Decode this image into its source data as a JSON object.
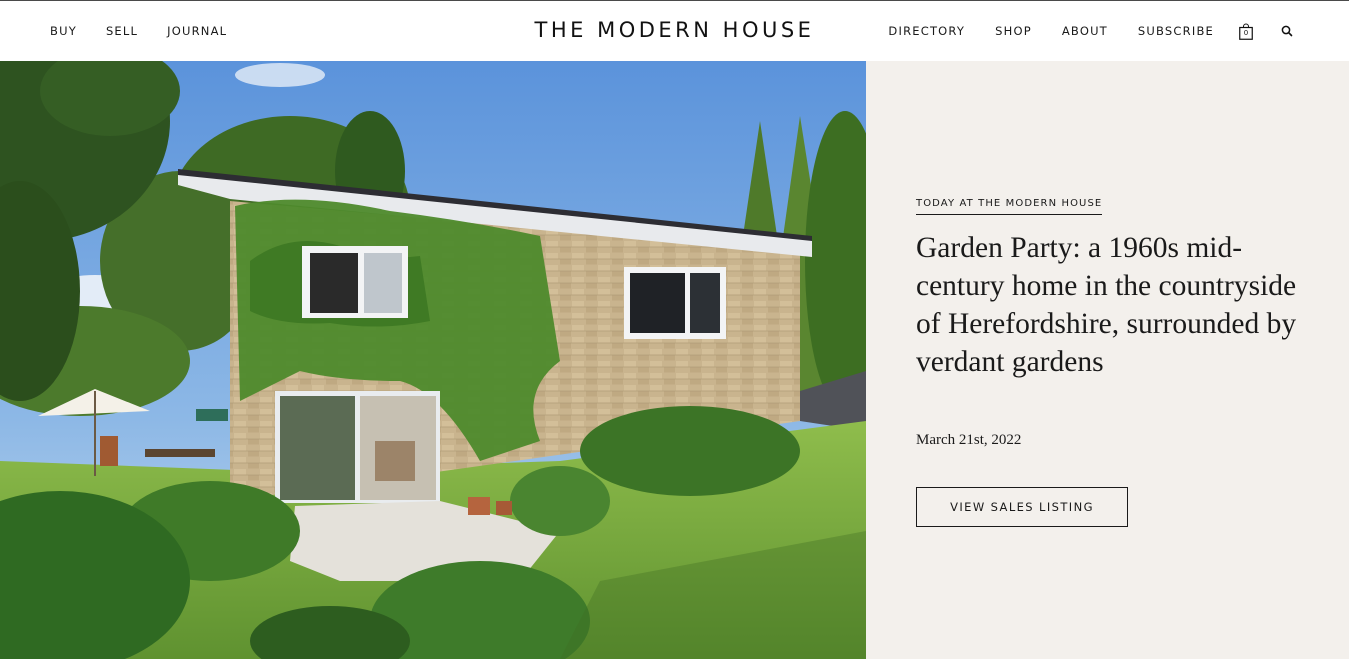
{
  "brand": {
    "name": "THE MODERN HOUSE"
  },
  "nav": {
    "left": [
      "BUY",
      "SELL",
      "JOURNAL"
    ],
    "right": [
      "DIRECTORY",
      "SHOP",
      "ABOUT",
      "SUBSCRIBE"
    ],
    "bag_count": "0",
    "icons": {
      "bag": "shopping-bag-icon",
      "search": "search-icon"
    }
  },
  "feature": {
    "kicker": "TODAY AT THE MODERN HOUSE",
    "headline": "Garden Party: a 1960s mid-century home in the countryside of Herefordshire, surrounded by verdant gardens",
    "date": "March 21st, 2022",
    "cta_label": "VIEW SALES LISTING"
  },
  "colors": {
    "panel_background": "#f3f0ec",
    "text": "#1a1a1a",
    "header_background": "#ffffff"
  }
}
